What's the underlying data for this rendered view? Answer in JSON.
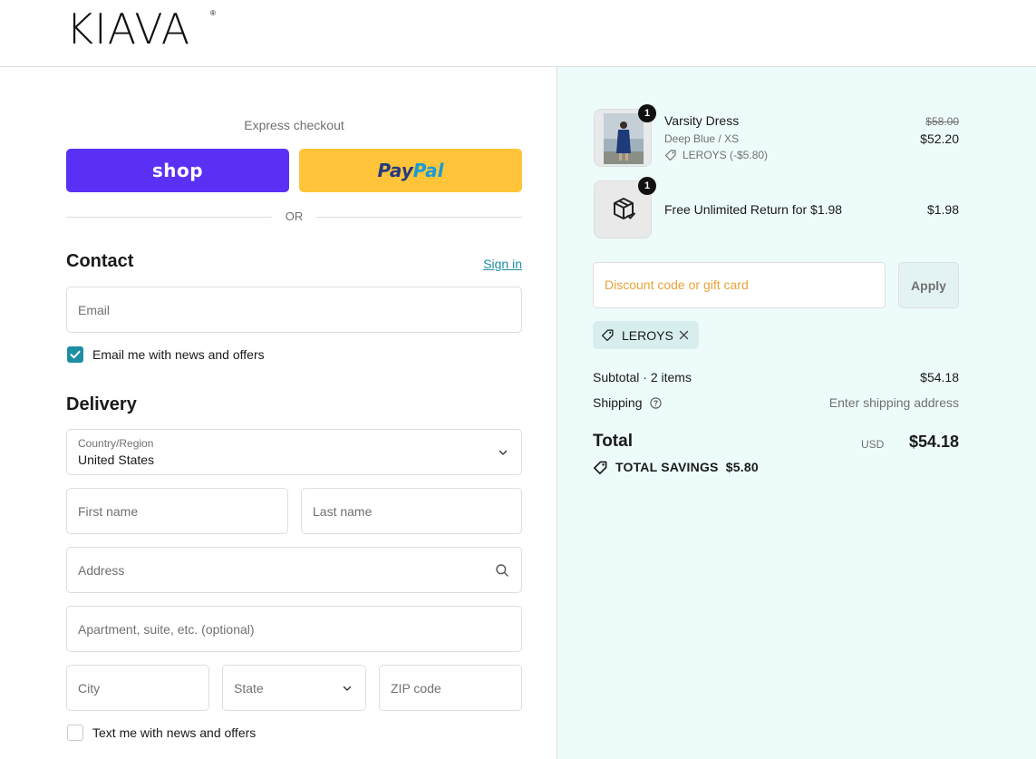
{
  "brand": {
    "name": "KIAVA",
    "reg": "®"
  },
  "express": {
    "label": "Express checkout",
    "shop_label": "shop",
    "paypal_label_1": "Pay",
    "paypal_label_2": "Pal",
    "or_label": "OR"
  },
  "contact": {
    "title": "Contact",
    "sign_in": "Sign in",
    "email_placeholder": "Email",
    "news_label": "Email me with news and offers",
    "news_checked": true
  },
  "delivery": {
    "title": "Delivery",
    "country_label": "Country/Region",
    "country_value": "United States",
    "first_name": "First name",
    "last_name": "Last name",
    "address": "Address",
    "apartment": "Apartment, suite, etc. (optional)",
    "city": "City",
    "state": "State",
    "zip": "ZIP code",
    "text_label": "Text me with news and offers",
    "text_checked": false
  },
  "cart": {
    "items": [
      {
        "name": "Varsity Dress",
        "variant": "Deep Blue / XS",
        "discount": "LEROYS (-$5.80)",
        "qty": "1",
        "price_old": "$58.00",
        "price": "$52.20"
      },
      {
        "name": "Free Unlimited Return for $1.98",
        "qty": "1",
        "price": "$1.98"
      }
    ],
    "discount_placeholder": "Discount code or gift card",
    "apply_label": "Apply",
    "applied_code": "LEROYS",
    "subtotal_label": "Subtotal · 2 items",
    "subtotal_value": "$54.18",
    "shipping_label": "Shipping",
    "shipping_value": "Enter shipping address",
    "total_label": "Total",
    "total_currency": "USD",
    "total_value": "$54.18",
    "savings_label": "TOTAL SAVINGS",
    "savings_value": "$5.80"
  },
  "colors": {
    "shop_purple": "#5a31f4",
    "paypal_yellow": "#ffc439",
    "accent_teal": "#1f8ea3",
    "summary_bg": "#eefbfb"
  },
  "icons": [
    "chevron-down-icon",
    "search-icon",
    "tag-icon",
    "close-icon",
    "help-icon",
    "package-check-icon",
    "checkmark-icon"
  ]
}
